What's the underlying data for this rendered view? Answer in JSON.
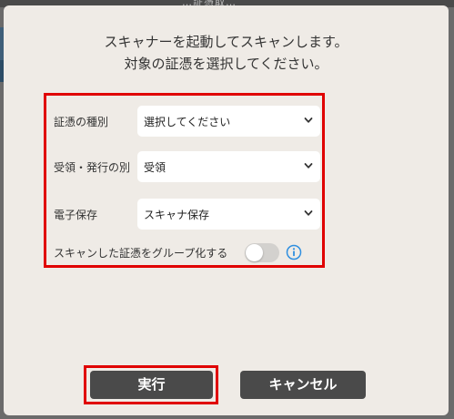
{
  "background": {
    "title": "…証憑取…"
  },
  "modal": {
    "instruction_line1": "スキャナーを起動してスキャンします。",
    "instruction_line2": "対象の証憑を選択してください。"
  },
  "form": {
    "voucher_type": {
      "label": "証憑の種別",
      "value": "選択してください"
    },
    "receive_issue": {
      "label": "受領・発行の別",
      "value": "受領"
    },
    "electronic_storage": {
      "label": "電子保存",
      "value": "スキャナ保存"
    },
    "group_toggle": {
      "label": "スキャンした証憑をグループ化する",
      "state": "off"
    }
  },
  "buttons": {
    "run_label": "実行",
    "cancel_label": "キャンセル"
  },
  "colors": {
    "highlight": "#e00000",
    "button_bg": "#4a4a4a",
    "info_icon": "#2f8fe0",
    "modal_bg": "#efebe6"
  },
  "icons": {
    "chevron": "chevron-down-icon",
    "info": "info-icon"
  }
}
